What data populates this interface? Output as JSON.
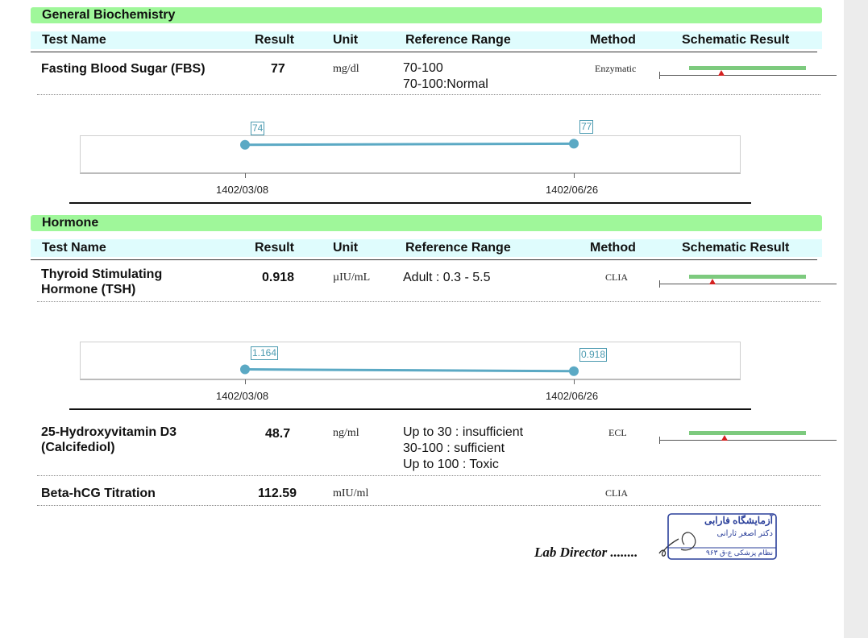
{
  "columns": {
    "test_name": "Test Name",
    "result": "Result",
    "unit": "Unit",
    "reference": "Reference Range",
    "method": "Method",
    "schematic": "Schematic Result"
  },
  "sections": {
    "biochem": {
      "title": "General Biochemistry",
      "fbs": {
        "name": "Fasting Blood Sugar (FBS)",
        "result": "77",
        "unit": "mg/dl",
        "ref": [
          "70-100",
          "70-100:Normal"
        ],
        "method": "Enzymatic",
        "schematic_position": 0.35
      }
    },
    "hormone": {
      "title": "Hormone",
      "tsh": {
        "name": [
          "Thyroid Stimulating",
          "Hormone (TSH)"
        ],
        "result": "0.918",
        "unit": "µIU/mL",
        "ref": [
          "Adult : 0.3 - 5.5"
        ],
        "method": "CLIA",
        "schematic_position": 0.3
      },
      "vitd": {
        "name": [
          "25-Hydroxyvitamin D3",
          "(Calcifediol)"
        ],
        "result": "48.7",
        "unit": "ng/ml",
        "ref": [
          "Up to 30 : insufficient",
          "30-100 : sufficient",
          "Up to 100 : Toxic"
        ],
        "method": "ECL",
        "schematic_position": 0.37
      },
      "hcg": {
        "name": "Beta-hCG Titration",
        "result": "112.59",
        "unit": "mIU/ml",
        "method": "CLIA"
      }
    }
  },
  "chart_data": [
    {
      "type": "line",
      "x": [
        "1402/03/08",
        "1402/06/26"
      ],
      "series": [
        {
          "values": [
            74,
            77
          ],
          "labels": [
            "74",
            "77"
          ]
        }
      ],
      "ylim": [
        0,
        100
      ]
    },
    {
      "type": "line",
      "x": [
        "1402/03/08",
        "1402/06/26"
      ],
      "series": [
        {
          "values": [
            1.164,
            0.918
          ],
          "labels": [
            "1.164",
            "0.918"
          ]
        }
      ],
      "ylim": [
        0,
        5
      ]
    }
  ],
  "footer": {
    "lab_director": "Lab Director ........"
  },
  "stamp": {
    "line1": "آزمایشگاه فارابی",
    "line2": "دکتر اصغر ثارانی",
    "line3": "نظام پزشکی ع-ق ۹۶۳"
  },
  "colors": {
    "section_bar": "#9ff79a",
    "header_bar": "#dffcfd",
    "chart_line": "#5ba9c4",
    "schematic_bar": "#7dca7e",
    "marker": "#d42020"
  }
}
